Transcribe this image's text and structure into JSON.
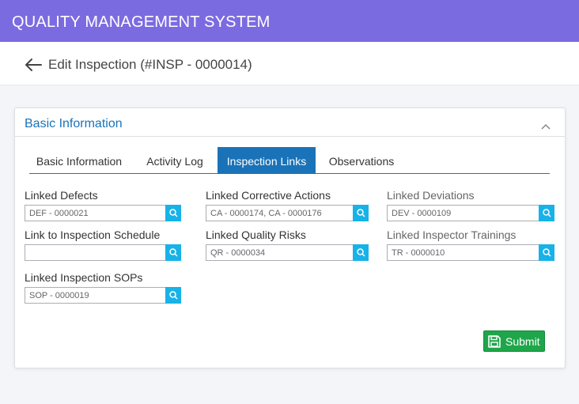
{
  "app": {
    "title": "QUALITY MANAGEMENT SYSTEM"
  },
  "page": {
    "title": "Edit Inspection (#INSP - 0000014)"
  },
  "card": {
    "title": "Basic Information"
  },
  "tabs": [
    {
      "label": "Basic Information",
      "active": false
    },
    {
      "label": "Activity Log",
      "active": false
    },
    {
      "label": "Inspection Links",
      "active": true
    },
    {
      "label": "Observations",
      "active": false
    }
  ],
  "fields": {
    "linked_defects": {
      "label": "Linked Defects",
      "value": "DEF - 0000021"
    },
    "linked_corrective_actions": {
      "label": "Linked Corrective Actions",
      "value": "CA - 0000174, CA - 0000176"
    },
    "linked_deviations": {
      "label": "Linked Deviations",
      "value": "DEV - 0000109"
    },
    "link_to_inspection_schedule": {
      "label": "Link to Inspection Schedule",
      "value": ""
    },
    "linked_quality_risks": {
      "label": "Linked Quality Risks",
      "value": "QR - 0000034"
    },
    "linked_inspector_trainings": {
      "label": "Linked Inspector Trainings",
      "value": "TR - 0000010"
    },
    "linked_inspection_sops": {
      "label": "Linked Inspection SOPs",
      "value": "SOP - 0000019"
    }
  },
  "submit": {
    "label": "Submit"
  },
  "icons": {
    "back": "arrow-left-icon",
    "collapse": "chevron-up-icon",
    "lookup": "search-icon",
    "save": "floppy-disk-icon"
  },
  "colors": {
    "topbar": "#7b6be0",
    "accent": "#1a73b8",
    "lookup_button": "#17b2e8",
    "submit": "#1fa64a"
  }
}
